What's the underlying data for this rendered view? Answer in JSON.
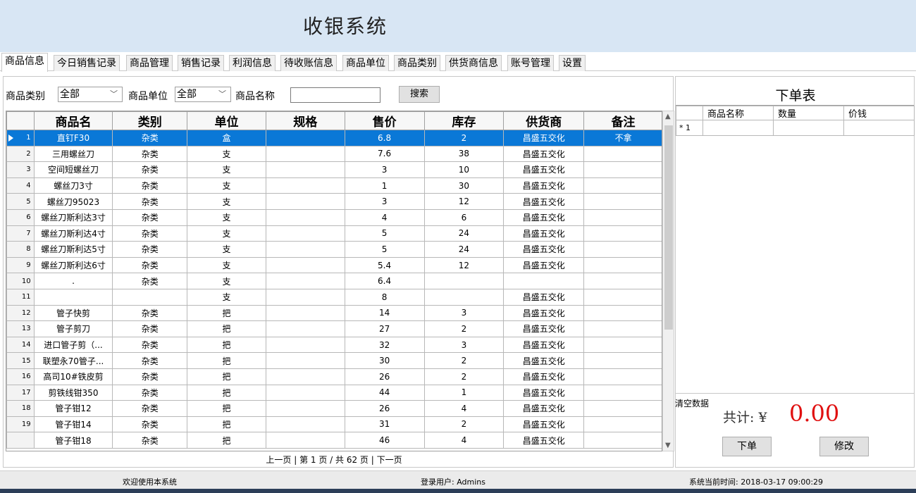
{
  "app": {
    "title": "收银系统"
  },
  "tabs": [
    "商品信息",
    "今日销售记录",
    "商品管理",
    "销售记录",
    "利润信息",
    "待收账信息",
    "商品单位",
    "商品类别",
    "供货商信息",
    "账号管理",
    "设置"
  ],
  "filter": {
    "category_label": "商品类别",
    "category_value": "全部",
    "unit_label": "商品单位",
    "unit_value": "全部",
    "name_label": "商品名称",
    "name_value": "",
    "search_label": "搜索"
  },
  "table": {
    "headers": [
      "商品名",
      "类别",
      "单位",
      "规格",
      "售价",
      "库存",
      "供货商",
      "备注"
    ],
    "rows": [
      {
        "no": "1",
        "name": "直钉F30",
        "category": "杂类",
        "unit": "盒",
        "spec": "",
        "price": "6.8",
        "stock": "2",
        "supplier": "昌盛五交化",
        "note": "不拿"
      },
      {
        "no": "2",
        "name": "三用螺丝刀",
        "category": "杂类",
        "unit": "支",
        "spec": "",
        "price": "7.6",
        "stock": "38",
        "supplier": "昌盛五交化",
        "note": ""
      },
      {
        "no": "3",
        "name": "空间短螺丝刀",
        "category": "杂类",
        "unit": "支",
        "spec": "",
        "price": "3",
        "stock": "10",
        "supplier": "昌盛五交化",
        "note": ""
      },
      {
        "no": "4",
        "name": "螺丝刀3寸",
        "category": "杂类",
        "unit": "支",
        "spec": "",
        "price": "1",
        "stock": "30",
        "supplier": "昌盛五交化",
        "note": ""
      },
      {
        "no": "5",
        "name": "螺丝刀95023",
        "category": "杂类",
        "unit": "支",
        "spec": "",
        "price": "3",
        "stock": "12",
        "supplier": "昌盛五交化",
        "note": ""
      },
      {
        "no": "6",
        "name": "螺丝刀斯利达3寸",
        "category": "杂类",
        "unit": "支",
        "spec": "",
        "price": "4",
        "stock": "6",
        "supplier": "昌盛五交化",
        "note": ""
      },
      {
        "no": "7",
        "name": "螺丝刀斯利达4寸",
        "category": "杂类",
        "unit": "支",
        "spec": "",
        "price": "5",
        "stock": "24",
        "supplier": "昌盛五交化",
        "note": ""
      },
      {
        "no": "8",
        "name": "螺丝刀斯利达5寸",
        "category": "杂类",
        "unit": "支",
        "spec": "",
        "price": "5",
        "stock": "24",
        "supplier": "昌盛五交化",
        "note": ""
      },
      {
        "no": "9",
        "name": "螺丝刀斯利达6寸",
        "category": "杂类",
        "unit": "支",
        "spec": "",
        "price": "5.4",
        "stock": "12",
        "supplier": "昌盛五交化",
        "note": ""
      },
      {
        "no": "10",
        "name": ".",
        "category": "杂类",
        "unit": "支",
        "spec": "",
        "price": "6.4",
        "stock": "",
        "supplier": "",
        "note": ""
      },
      {
        "no": "11",
        "name": "",
        "category": "",
        "unit": "支",
        "spec": "",
        "price": "8",
        "stock": "",
        "supplier": "昌盛五交化",
        "note": ""
      },
      {
        "no": "12",
        "name": "管子快剪",
        "category": "杂类",
        "unit": "把",
        "spec": "",
        "price": "14",
        "stock": "3",
        "supplier": "昌盛五交化",
        "note": ""
      },
      {
        "no": "13",
        "name": "管子剪刀",
        "category": "杂类",
        "unit": "把",
        "spec": "",
        "price": "27",
        "stock": "2",
        "supplier": "昌盛五交化",
        "note": ""
      },
      {
        "no": "14",
        "name": "进口管子剪（...",
        "category": "杂类",
        "unit": "把",
        "spec": "",
        "price": "32",
        "stock": "3",
        "supplier": "昌盛五交化",
        "note": ""
      },
      {
        "no": "15",
        "name": "联塑永70管子...",
        "category": "杂类",
        "unit": "把",
        "spec": "",
        "price": "30",
        "stock": "2",
        "supplier": "昌盛五交化",
        "note": ""
      },
      {
        "no": "16",
        "name": "高司10#铁皮剪",
        "category": "杂类",
        "unit": "把",
        "spec": "",
        "price": "26",
        "stock": "2",
        "supplier": "昌盛五交化",
        "note": ""
      },
      {
        "no": "17",
        "name": "剪铁线钳350",
        "category": "杂类",
        "unit": "把",
        "spec": "",
        "price": "44",
        "stock": "1",
        "supplier": "昌盛五交化",
        "note": ""
      },
      {
        "no": "18",
        "name": "管子钳12",
        "category": "杂类",
        "unit": "把",
        "spec": "",
        "price": "26",
        "stock": "4",
        "supplier": "昌盛五交化",
        "note": ""
      },
      {
        "no": "19",
        "name": "管子钳14",
        "category": "杂类",
        "unit": "把",
        "spec": "",
        "price": "31",
        "stock": "2",
        "supplier": "昌盛五交化",
        "note": ""
      },
      {
        "no": "",
        "name": "管子钳18",
        "category": "杂类",
        "unit": "把",
        "spec": "",
        "price": "46",
        "stock": "4",
        "supplier": "昌盛五交化",
        "note": ""
      }
    ]
  },
  "pager": {
    "text": "上一页 | 第 1 页 / 共 62 页 | 下一页"
  },
  "order": {
    "title": "下单表",
    "headers": [
      "商品名称",
      "数量",
      "价钱"
    ],
    "row_marker": "* 1",
    "clear_label": "清空数据",
    "total_label": "共计: ¥",
    "total_value": "0.00",
    "submit_label": "下单",
    "edit_label": "修改"
  },
  "status": {
    "welcome": "欢迎使用本系统",
    "user": "登录用户: Admins",
    "time": "系统当前时间: 2018-03-17 09:00:29"
  },
  "colors": {
    "selection": "#0a78d7",
    "total": "#e01010",
    "header_bg": "#d8e6f4"
  }
}
